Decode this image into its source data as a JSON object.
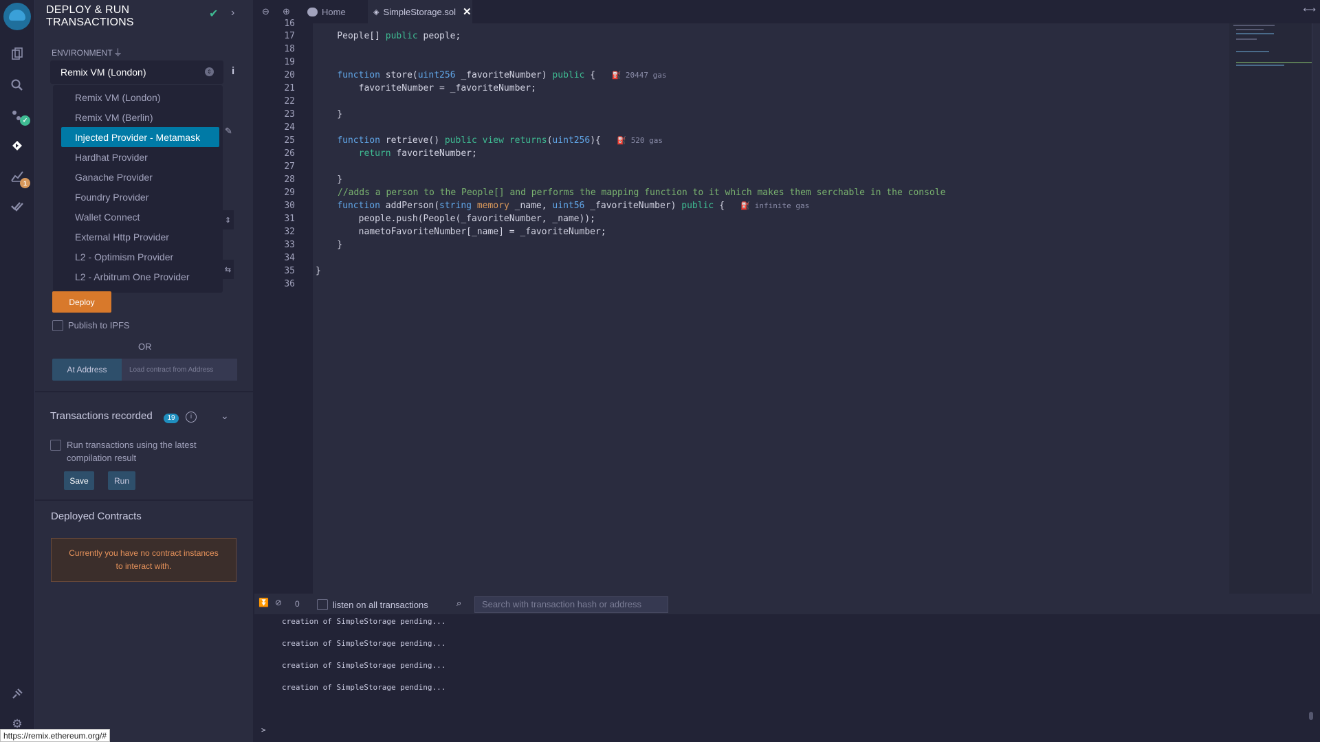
{
  "panel": {
    "title": "DEPLOY & RUN\nTRANSACTIONS",
    "environment_label": "ENVIRONMENT",
    "environment_selected": "Remix VM (London)",
    "environment_options": [
      "Remix VM (London)",
      "Remix VM (Berlin)",
      "Injected Provider - Metamask",
      "Hardhat Provider",
      "Ganache Provider",
      "Foundry Provider",
      "Wallet Connect",
      "External Http Provider",
      "L2 - Optimism Provider",
      "L2 - Arbitrum One Provider"
    ],
    "deploy_label": "Deploy",
    "publish_label": "Publish to IPFS",
    "or_label": "OR",
    "at_address_label": "At Address",
    "load_contract_placeholder": "Load contract from Address",
    "transactions_recorded_label": "Transactions recorded",
    "transactions_count": "19",
    "run_latest_label": "Run transactions using the latest compilation result",
    "save_label": "Save",
    "run_label": "Run",
    "deployed_contracts_label": "Deployed Contracts",
    "no_instances_message": "Currently you have no contract instances to interact with."
  },
  "rail": {
    "analysis_badge": "1"
  },
  "tabs": {
    "home_label": "Home",
    "file_label": "SimpleStorage.sol"
  },
  "editor": {
    "line_numbers": [
      "16",
      "17",
      "18",
      "19",
      "20",
      "21",
      "22",
      "23",
      "24",
      "25",
      "26",
      "27",
      "28",
      "29",
      "30",
      "31",
      "32",
      "33",
      "34",
      "35",
      "36"
    ],
    "gas_store": "20447 gas",
    "gas_retrieve": "520 gas",
    "gas_add_person": "infinite gas",
    "comment_line": "//adds a person to the People[] and performs the mapping function to it which makes them serchable in the console"
  },
  "terminal": {
    "count": "0",
    "listen_label": "listen on all transactions",
    "search_placeholder": "Search with transaction hash or address",
    "lines": [
      "creation of SimpleStorage pending...",
      "creation of SimpleStorage pending...",
      "creation of SimpleStorage pending...",
      "creation of SimpleStorage pending..."
    ],
    "prompt": ">"
  },
  "status_url": "https://remix.ethereum.org/#"
}
